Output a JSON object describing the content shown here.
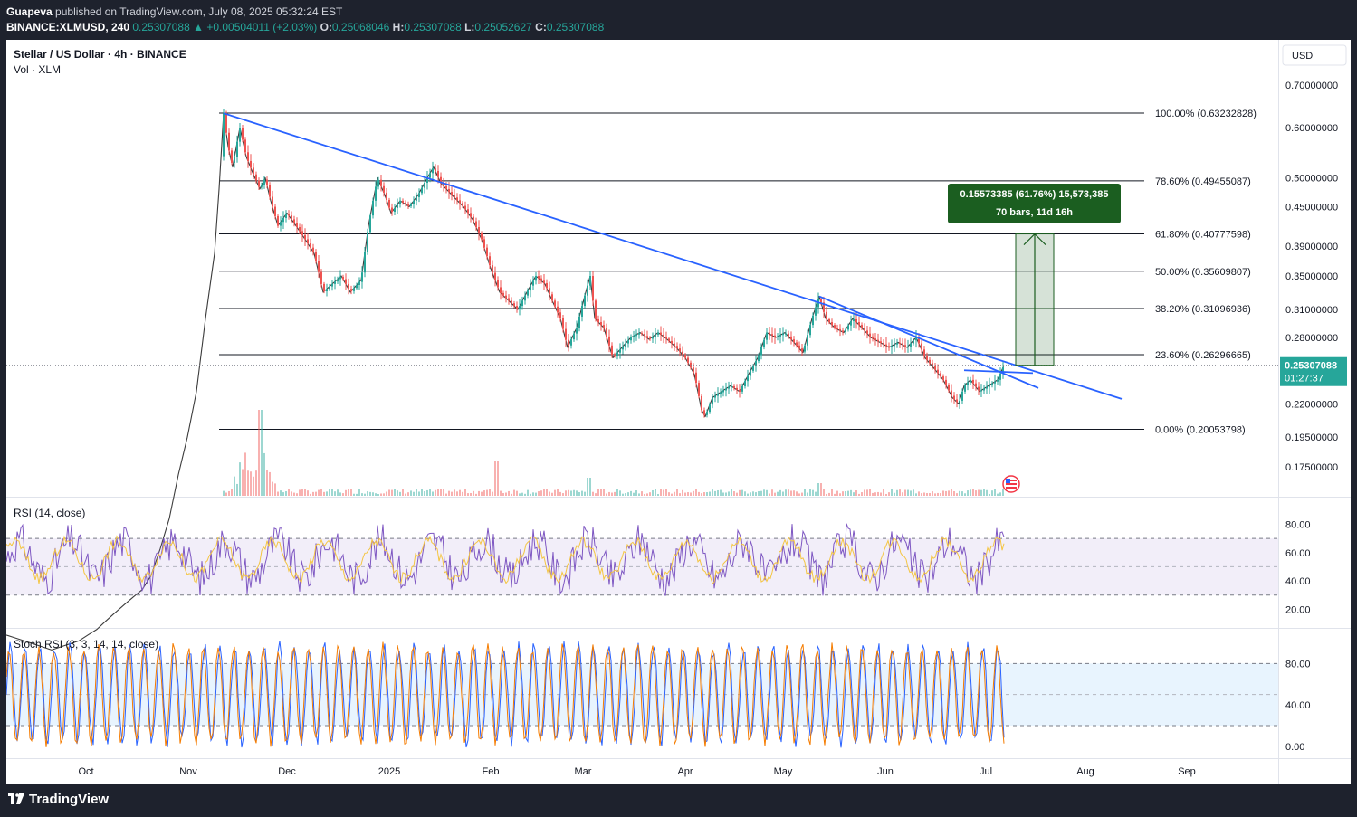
{
  "header": {
    "author": "Guapeva",
    "published_text": "published on TradingView.com, July 08, 2025 05:32:24 EST",
    "symbol": "BINANCE:XLMUSD, 240",
    "last": "0.25307088",
    "change": "+0.00504011 (+2.03%)",
    "open_label": "O:",
    "open": "0.25068046",
    "high_label": "H:",
    "high": "0.25307088",
    "low_label": "L:",
    "low": "0.25052627",
    "close_label": "C:",
    "close": "0.25307088"
  },
  "legend": {
    "title": "Stellar / US Dollar · 4h · BINANCE",
    "vol": "Vol · XLM",
    "currency_button": "USD"
  },
  "price_scale": {
    "ticks": [
      "0.70000000",
      "0.60000000",
      "0.50000000",
      "0.45000000",
      "0.39000000",
      "0.35000000",
      "0.31000000",
      "0.28000000",
      "0.22000000",
      "0.19500000",
      "0.17500000"
    ],
    "tick_values": [
      0.7,
      0.6,
      0.5,
      0.45,
      0.39,
      0.35,
      0.31,
      0.28,
      0.22,
      0.195,
      0.175
    ],
    "current_price": "0.25307088",
    "countdown": "01:27:37"
  },
  "fib_levels": [
    {
      "label": "100.00% (0.63232828)",
      "value": 0.63232828
    },
    {
      "label": "78.60% (0.49455087)",
      "value": 0.49455087
    },
    {
      "label": "61.80% (0.40777598)",
      "value": 0.40777598
    },
    {
      "label": "50.00% (0.35609807)",
      "value": 0.35609807
    },
    {
      "label": "38.20% (0.31096936)",
      "value": 0.31096936
    },
    {
      "label": "23.60% (0.26296665)",
      "value": 0.26296665
    },
    {
      "label": "0.00% (0.20053798)",
      "value": 0.20053798
    }
  ],
  "measure": {
    "line1": "0.15573385 (61.76%) 15,573,385",
    "line2": "70 bars, 11d 16h",
    "from": 0.25307088,
    "to": 0.40777598
  },
  "rsi": {
    "title": "RSI (14, close)",
    "ticks": [
      "80.00",
      "60.00",
      "40.00",
      "20.00"
    ],
    "tick_values": [
      80,
      60,
      40,
      20
    ],
    "upper_band": 70,
    "lower_band": 30
  },
  "stoch": {
    "title": "Stoch RSI (3, 3, 14, 14, close)",
    "ticks": [
      "80.00",
      "40.00",
      "0.00"
    ],
    "tick_values": [
      80,
      40,
      0
    ],
    "upper_band": 80,
    "lower_band": 20
  },
  "time_axis": {
    "labels": [
      "Oct",
      "Nov",
      "Dec",
      "2025",
      "Feb",
      "Mar",
      "Apr",
      "May",
      "Jun",
      "Jul",
      "Aug",
      "Sep"
    ]
  },
  "footer": {
    "brand": "TradingView"
  },
  "colors": {
    "trendline": "#2962ff",
    "rsi_line": "#7e57c2",
    "rsi_ma": "#f4c542",
    "stoch_k": "#2962ff",
    "stoch_d": "#f57c00",
    "up": "#26a69a",
    "measure": "#1b5e20"
  },
  "chart_data": {
    "type": "line",
    "title": "Stellar / US Dollar · 4h · BINANCE",
    "x_labels": [
      "Oct",
      "Nov",
      "Dec",
      "2025",
      "Feb",
      "Mar",
      "Apr",
      "May",
      "Jun",
      "Jul",
      "Aug",
      "Sep"
    ],
    "series": [
      {
        "name": "XLMUSD",
        "values": [
          [
            0,
            0.095
          ],
          [
            10,
            0.094
          ],
          [
            20,
            0.093
          ],
          [
            30,
            0.092
          ],
          [
            40,
            0.091
          ],
          [
            50,
            0.09
          ],
          [
            60,
            0.091
          ],
          [
            70,
            0.092
          ],
          [
            80,
            0.093
          ],
          [
            90,
            0.095
          ],
          [
            100,
            0.097
          ],
          [
            110,
            0.1
          ],
          [
            120,
            0.103
          ],
          [
            130,
            0.106
          ],
          [
            140,
            0.109
          ],
          [
            150,
            0.112
          ],
          [
            160,
            0.118
          ],
          [
            170,
            0.13
          ],
          [
            180,
            0.145
          ],
          [
            190,
            0.17
          ],
          [
            200,
            0.195
          ],
          [
            210,
            0.23
          ],
          [
            220,
            0.3
          ],
          [
            230,
            0.38
          ],
          [
            235,
            0.48
          ],
          [
            240,
            0.632
          ],
          [
            245,
            0.56
          ],
          [
            250,
            0.52
          ],
          [
            258,
            0.6
          ],
          [
            265,
            0.54
          ],
          [
            272,
            0.51
          ],
          [
            280,
            0.48
          ],
          [
            286,
            0.5
          ],
          [
            292,
            0.46
          ],
          [
            300,
            0.42
          ],
          [
            310,
            0.44
          ],
          [
            320,
            0.42
          ],
          [
            330,
            0.4
          ],
          [
            340,
            0.38
          ],
          [
            350,
            0.33
          ],
          [
            360,
            0.34
          ],
          [
            370,
            0.35
          ],
          [
            380,
            0.33
          ],
          [
            392,
            0.345
          ],
          [
            400,
            0.42
          ],
          [
            410,
            0.5
          ],
          [
            418,
            0.47
          ],
          [
            425,
            0.44
          ],
          [
            435,
            0.46
          ],
          [
            445,
            0.45
          ],
          [
            455,
            0.47
          ],
          [
            465,
            0.5
          ],
          [
            472,
            0.52
          ],
          [
            480,
            0.49
          ],
          [
            492,
            0.47
          ],
          [
            505,
            0.45
          ],
          [
            515,
            0.43
          ],
          [
            525,
            0.4
          ],
          [
            535,
            0.36
          ],
          [
            545,
            0.33
          ],
          [
            555,
            0.32
          ],
          [
            565,
            0.31
          ],
          [
            575,
            0.33
          ],
          [
            585,
            0.35
          ],
          [
            595,
            0.34
          ],
          [
            603,
            0.32
          ],
          [
            612,
            0.3
          ],
          [
            620,
            0.27
          ],
          [
            630,
            0.29
          ],
          [
            640,
            0.33
          ],
          [
            645,
            0.35
          ],
          [
            650,
            0.3
          ],
          [
            660,
            0.29
          ],
          [
            670,
            0.26
          ],
          [
            680,
            0.27
          ],
          [
            690,
            0.28
          ],
          [
            700,
            0.285
          ],
          [
            710,
            0.278
          ],
          [
            720,
            0.285
          ],
          [
            730,
            0.278
          ],
          [
            740,
            0.27
          ],
          [
            750,
            0.26
          ],
          [
            760,
            0.245
          ],
          [
            768,
            0.215
          ],
          [
            772,
            0.21
          ],
          [
            780,
            0.225
          ],
          [
            790,
            0.23
          ],
          [
            800,
            0.235
          ],
          [
            810,
            0.23
          ],
          [
            820,
            0.245
          ],
          [
            830,
            0.26
          ],
          [
            840,
            0.285
          ],
          [
            850,
            0.28
          ],
          [
            860,
            0.285
          ],
          [
            870,
            0.275
          ],
          [
            880,
            0.265
          ],
          [
            890,
            0.3
          ],
          [
            898,
            0.325
          ],
          [
            905,
            0.3
          ],
          [
            915,
            0.29
          ],
          [
            925,
            0.285
          ],
          [
            935,
            0.3
          ],
          [
            945,
            0.29
          ],
          [
            955,
            0.28
          ],
          [
            965,
            0.275
          ],
          [
            975,
            0.27
          ],
          [
            985,
            0.275
          ],
          [
            995,
            0.27
          ],
          [
            1005,
            0.28
          ],
          [
            1015,
            0.26
          ],
          [
            1025,
            0.25
          ],
          [
            1035,
            0.24
          ],
          [
            1045,
            0.225
          ],
          [
            1052,
            0.22
          ],
          [
            1058,
            0.235
          ],
          [
            1065,
            0.24
          ],
          [
            1075,
            0.23
          ],
          [
            1085,
            0.235
          ],
          [
            1095,
            0.24
          ],
          [
            1102,
            0.253
          ]
        ]
      }
    ],
    "trendlines": [
      {
        "x1": 240,
        "y1": 0.632,
        "x2": 1232,
        "y2": 0.224
      },
      {
        "x1": 898,
        "y1": 0.325,
        "x2": 1140,
        "y2": 0.233
      },
      {
        "x1": 1058,
        "y1": 0.2485,
        "x2": 1134,
        "y2": 0.246
      }
    ],
    "ylim": [
      0.16,
      0.73
    ],
    "y_scale": "log"
  }
}
